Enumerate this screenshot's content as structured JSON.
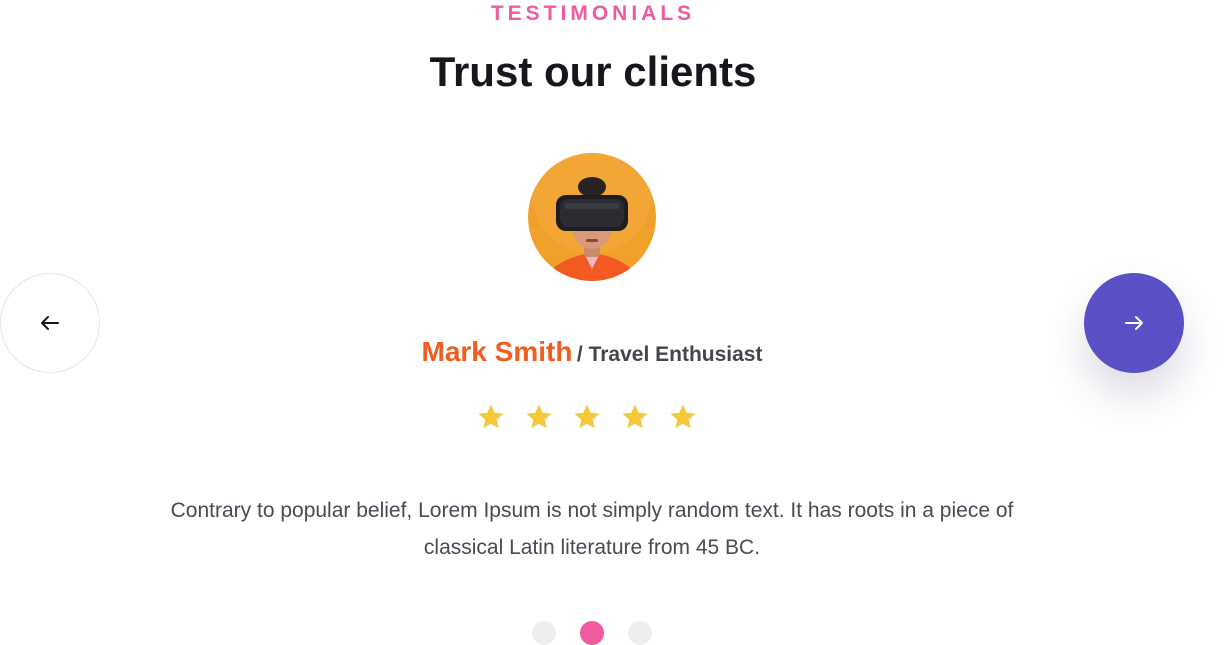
{
  "section": {
    "eyebrow": "TESTIMONIALS",
    "title": "Trust our clients"
  },
  "testimonial": {
    "name": "Mark Smith",
    "role": "/ Travel Enthusiast",
    "rating": 5,
    "rating_max": 5,
    "quote": "Contrary to popular belief, Lorem Ipsum is not simply random text. It has roots in a piece of classical Latin literature from 45 BC."
  },
  "navigation": {
    "prev_icon": "arrow-left-icon",
    "next_icon": "arrow-right-icon"
  },
  "pagination": {
    "total": 3,
    "active_index": 1
  },
  "colors": {
    "eyebrow": "#f25aa0",
    "author_name": "#f25c1f",
    "next_button": "#5b4fc6",
    "star": "#f5c73b",
    "active_dot": "#f25aa0",
    "avatar_background": "#f0a12c"
  }
}
